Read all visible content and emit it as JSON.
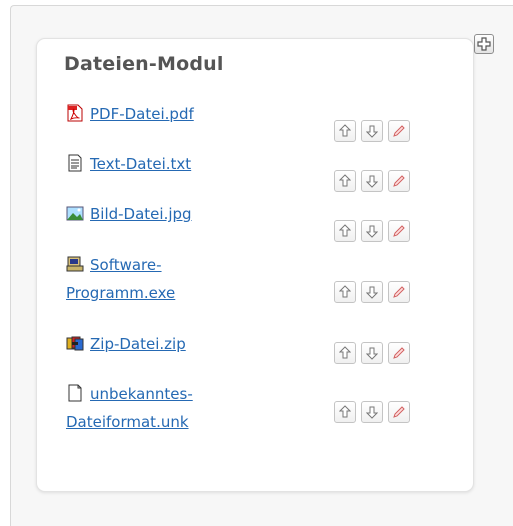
{
  "module": {
    "title": "Dateien-Modul"
  },
  "files": [
    {
      "name": "PDF-Datei.pdf",
      "icon": "pdf-file-icon"
    },
    {
      "name": "Text-Datei.txt",
      "icon": "text-file-icon"
    },
    {
      "name": "Bild-Datei.jpg",
      "icon": "image-file-icon"
    },
    {
      "name_line1": "Software-",
      "name_line2": "Programm.exe",
      "icon": "program-file-icon"
    },
    {
      "name": "Zip-Datei.zip",
      "icon": "zip-file-icon"
    },
    {
      "name_line1": "unbekanntes-",
      "name_line2": "Dateiformat.unk",
      "icon": "unknown-file-icon"
    }
  ],
  "colors": {
    "link": "#2569b3",
    "title": "#555555",
    "edit_pencil": "#e07b7b"
  }
}
